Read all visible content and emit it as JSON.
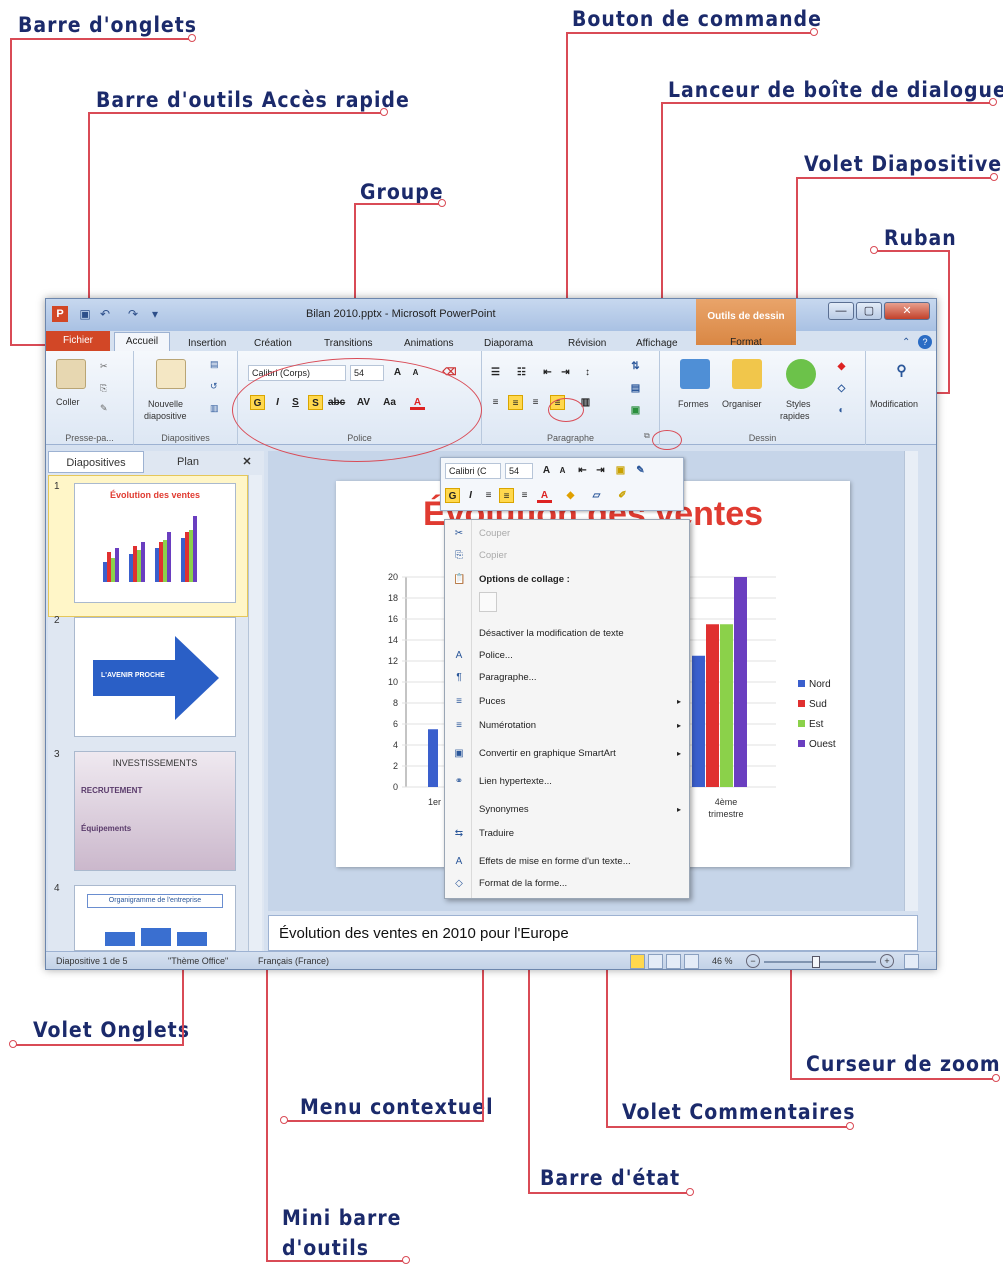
{
  "callouts": {
    "barre_onglets": "Barre d'onglets",
    "barre_acces": "Barre d'outils Accès rapide",
    "groupe": "Groupe",
    "bouton_commande": "Bouton de commande",
    "lanceur": "Lanceur de boîte de dialogue",
    "volet_diapositive": "Volet Diapositive",
    "ruban": "Ruban",
    "volet_onglets": "Volet Onglets",
    "curseur_zoom": "Curseur de zoom",
    "menu_contextuel": "Menu contextuel",
    "volet_commentaires": "Volet Commentaires",
    "barre_etat": "Barre d'état",
    "mini_barre_1": "Mini barre",
    "mini_barre_2": "d'outils"
  },
  "window": {
    "title": "Bilan 2010.pptx - Microsoft PowerPoint",
    "app_icon": "P",
    "contextual_tab": "Outils de dessin",
    "contextual_sub": "Format"
  },
  "tabs": [
    "Fichier",
    "Accueil",
    "Insertion",
    "Création",
    "Transitions",
    "Animations",
    "Diaporama",
    "Révision",
    "Affichage"
  ],
  "ribbon": {
    "groups": {
      "presse": "Presse-pa...",
      "diapos": "Diapositives",
      "police": "Police",
      "paragraphe": "Paragraphe",
      "dessin": "Dessin"
    },
    "coller": "Coller",
    "nouvelle": "Nouvelle",
    "diapositive": "diapositive",
    "font_name": "Calibri (Corps)",
    "font_size": "54",
    "formes": "Formes",
    "organiser": "Organiser",
    "styles": "Styles",
    "rapides": "rapides",
    "modification": "Modification"
  },
  "pane": {
    "tab_slides": "Diapositives",
    "tab_plan": "Plan",
    "close": "✕",
    "thumbs": [
      {
        "num": "1",
        "title": "Évolution des ventes"
      },
      {
        "num": "2",
        "title": "L'AVENIR PROCHE"
      },
      {
        "num": "3",
        "title": "INVESTISSEMENTS",
        "h1": "RECRUTEMENT",
        "h2": "Équipements"
      },
      {
        "num": "4",
        "title": "Organigramme de l'entreprise"
      }
    ]
  },
  "slide": {
    "title": "Évolution des ventes",
    "chart_data": {
      "type": "bar",
      "title": "",
      "categories": [
        "1er",
        "4ème trimestre"
      ],
      "series": [
        {
          "name": "Nord",
          "color": "#3a5fcd"
        },
        {
          "name": "Sud",
          "color": "#e03030"
        },
        {
          "name": "Est",
          "color": "#8bd14a"
        },
        {
          "name": "Ouest",
          "color": "#6a3ec0"
        }
      ],
      "values_visible": [
        [
          5.5
        ],
        [
          12.5,
          15.5,
          15.5,
          20
        ]
      ],
      "yticks": [
        "20",
        "18",
        "16",
        "14",
        "12",
        "10",
        "8",
        "6",
        "4",
        "2",
        "0"
      ],
      "ylim": [
        0,
        20
      ]
    }
  },
  "minibar": {
    "font": "Calibri (C",
    "size": "54"
  },
  "context_menu": {
    "items": [
      {
        "label": "Couper",
        "icon": "✂",
        "disabled": true
      },
      {
        "label": "Copier",
        "icon": "⎘",
        "disabled": true
      },
      {
        "label": "Options de collage :",
        "icon": "📋",
        "bold": true
      },
      {
        "label": "",
        "icon": ""
      },
      {
        "label": "Désactiver la modification de texte",
        "icon": ""
      },
      {
        "label": "Police...",
        "icon": "A"
      },
      {
        "label": "Paragraphe...",
        "icon": "¶"
      },
      {
        "label": "Puces",
        "icon": "≡",
        "arrow": "▸"
      },
      {
        "label": "Numérotation",
        "icon": "≡",
        "arrow": "▸"
      },
      {
        "label": "Convertir en graphique SmartArt",
        "icon": "▣",
        "arrow": "▸"
      },
      {
        "label": "Lien hypertexte...",
        "icon": "⚭"
      },
      {
        "label": "Synonymes",
        "icon": "",
        "arrow": "▸"
      },
      {
        "label": "Traduire",
        "icon": "⇆"
      },
      {
        "label": "Effets de mise en forme d'un texte...",
        "icon": "A"
      },
      {
        "label": "Format de la forme...",
        "icon": "◇"
      }
    ]
  },
  "notes": "Évolution des ventes en 2010 pour l'Europe",
  "status": {
    "slide": "Diapositive 1 de 5",
    "theme": "\"Thème Office\"",
    "lang": "Français (France)",
    "zoom": "46 %",
    "zoom_level": 0.46
  }
}
